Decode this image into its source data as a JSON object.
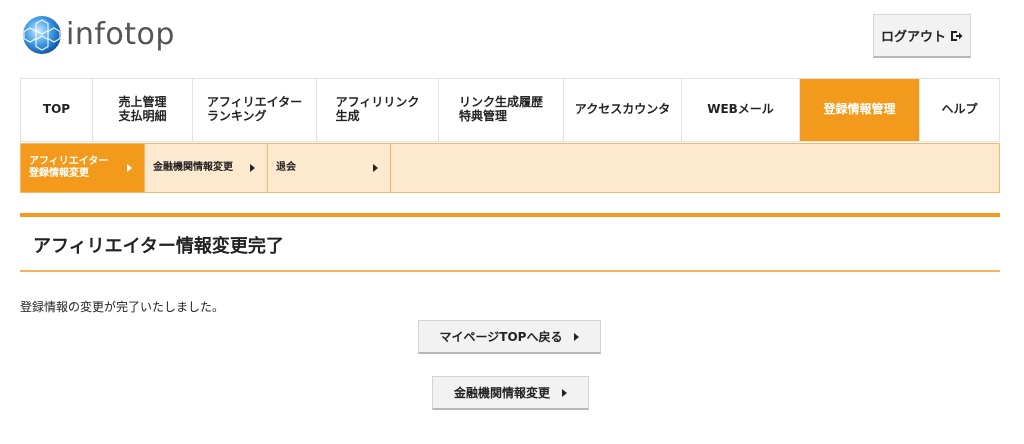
{
  "header": {
    "logo_text": "infotop",
    "logout_label": "ログアウト"
  },
  "main_nav": [
    {
      "id": "top",
      "label": "TOP",
      "active": false
    },
    {
      "id": "sales",
      "label": "売上管理\n支払明細",
      "active": false
    },
    {
      "id": "ranking",
      "label": "アフィリエイター\nランキング",
      "active": false
    },
    {
      "id": "link",
      "label": "アフィリリンク\n生成",
      "active": false
    },
    {
      "id": "history",
      "label": "リンク生成履歴\n特典管理",
      "active": false
    },
    {
      "id": "access",
      "label": "アクセスカウンタ",
      "active": false
    },
    {
      "id": "webmail",
      "label": "WEBメール",
      "active": false
    },
    {
      "id": "registration",
      "label": "登録情報管理",
      "active": true
    },
    {
      "id": "help",
      "label": "ヘルプ",
      "active": false
    }
  ],
  "sub_nav": [
    {
      "id": "affiliator-info",
      "label": "アフィリエイター\n登録情報変更",
      "active": true
    },
    {
      "id": "bank-info",
      "label": "金融機関情報変更",
      "active": false
    },
    {
      "id": "withdraw",
      "label": "退会",
      "active": false
    }
  ],
  "main": {
    "title": "アフィリエイター情報変更完了",
    "message": "登録情報の変更が完了いたしました。",
    "mypage_button": "マイページTOPへ戻る",
    "bank_button": "金融機関情報変更"
  },
  "colors": {
    "accent": "#f39a1c",
    "subnav_bg": "#fde9cf"
  },
  "icons": {
    "logo": "hexagon-globe-icon",
    "logout": "logout-arrow-icon",
    "arrow": "triangle-right-icon"
  }
}
